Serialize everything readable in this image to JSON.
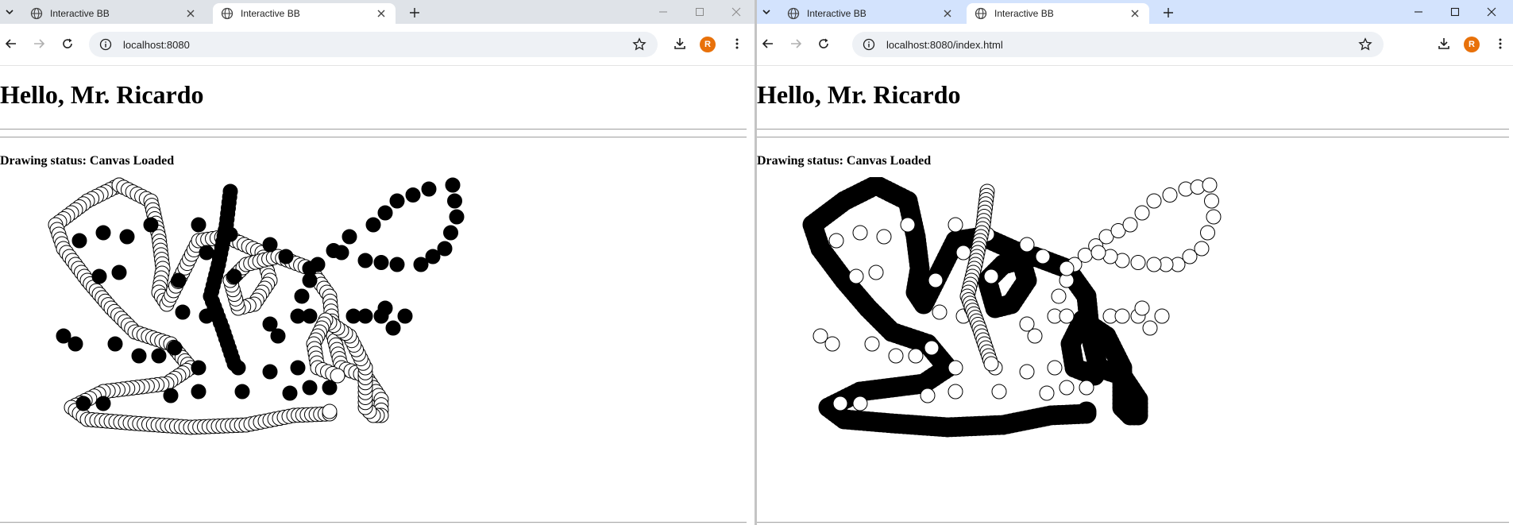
{
  "windows": {
    "left": {
      "tabs": [
        {
          "title": "Interactive BB",
          "active": false
        },
        {
          "title": "Interactive BB",
          "active": true
        }
      ],
      "url": "localhost:8080",
      "profile_initial": "R",
      "heading": "Hello, Mr. Ricardo",
      "status_label": "Drawing status:",
      "status_value": "Canvas Loaded"
    },
    "right": {
      "tabs": [
        {
          "title": "Interactive BB",
          "active": false
        },
        {
          "title": "Interactive BB",
          "active": true
        }
      ],
      "url": "localhost:8080/index.html",
      "profile_initial": "R",
      "heading": "Hello, Mr. Ricardo",
      "status_label": "Drawing status:",
      "status_value": "Canvas Loaded"
    }
  },
  "colors": {
    "left_tabstrip": "#dfe3e8",
    "right_tabstrip": "#d3e3fd",
    "profile": "#e8710a",
    "stroke": "#000000",
    "fill_hollow": "#ffffff"
  },
  "icons": [
    "tab-search-icon",
    "globe-icon",
    "close-icon",
    "plus-icon",
    "minimize-icon",
    "maximize-icon",
    "back-icon",
    "forward-icon",
    "reload-icon",
    "info-icon",
    "star-icon",
    "download-icon",
    "more-icon"
  ]
}
